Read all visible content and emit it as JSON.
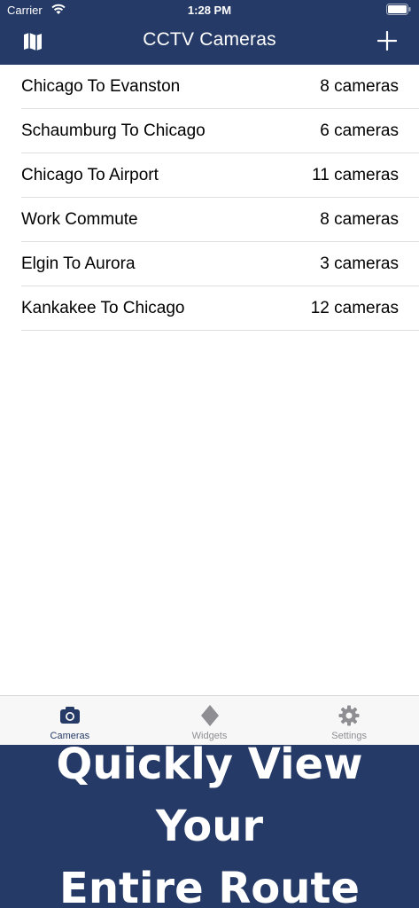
{
  "status_bar": {
    "carrier": "Carrier",
    "time": "1:28 PM"
  },
  "nav": {
    "title": "CCTV Cameras",
    "left_icon": "map-icon",
    "right_icon": "plus-icon"
  },
  "routes": [
    {
      "name": "Chicago To Evanston",
      "count": "8 cameras"
    },
    {
      "name": "Schaumburg To Chicago",
      "count": "6 cameras"
    },
    {
      "name": "Chicago To Airport",
      "count": "11 cameras"
    },
    {
      "name": "Work Commute",
      "count": "8 cameras"
    },
    {
      "name": "Elgin To Aurora",
      "count": "3 cameras"
    },
    {
      "name": "Kankakee To Chicago",
      "count": "12 cameras"
    }
  ],
  "tabs": [
    {
      "label": "Cameras",
      "icon": "camera-icon",
      "active": true
    },
    {
      "label": "Widgets",
      "icon": "diamond-icon",
      "active": false
    },
    {
      "label": "Settings",
      "icon": "gear-icon",
      "active": false
    }
  ],
  "promo": {
    "line1": "Quickly View Your",
    "line2": "Entire Route"
  },
  "colors": {
    "brand": "#253a66",
    "active_tab": "#253a66",
    "inactive_tab": "#8e8e93"
  }
}
